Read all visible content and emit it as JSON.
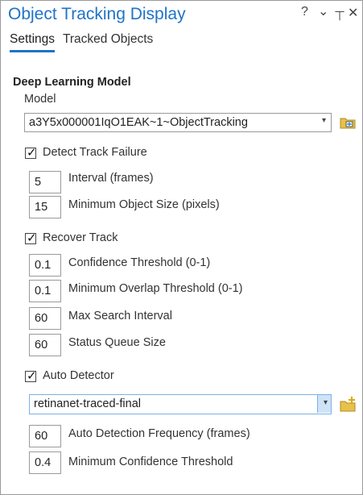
{
  "window": {
    "title": "Object Tracking Display",
    "help": "?",
    "menu": "⌄",
    "pin": "⊥",
    "close": "✕"
  },
  "tabs": [
    {
      "label": "Settings",
      "active": true
    },
    {
      "label": "Tracked Objects",
      "active": false
    }
  ],
  "section": {
    "title": "Deep Learning Model"
  },
  "model": {
    "label": "Model",
    "value": "a3Y5x000001IqO1EAK~1~ObjectTracking"
  },
  "detect_track_failure": {
    "label": "Detect Track Failure",
    "checked": true,
    "interval": {
      "label": "Interval (frames)",
      "value": "5"
    },
    "min_object_size": {
      "label": "Minimum Object Size (pixels)",
      "value": "15"
    }
  },
  "recover_track": {
    "label": "Recover Track",
    "checked": true,
    "confidence_threshold": {
      "label": "Confidence Threshold (0-1)",
      "value": "0.1"
    },
    "min_overlap_threshold": {
      "label": "Minimum Overlap Threshold (0-1)",
      "value": "0.1"
    },
    "max_search_interval": {
      "label": "Max Search Interval",
      "value": "60"
    },
    "status_queue_size": {
      "label": "Status Queue Size",
      "value": "60"
    }
  },
  "auto_detector": {
    "label": "Auto Detector",
    "checked": true,
    "value": "retinanet-traced-final",
    "detection_frequency": {
      "label": "Auto Detection Frequency (frames)",
      "value": "60"
    },
    "min_confidence": {
      "label": "Minimum Confidence Threshold",
      "value": "0.4"
    }
  },
  "icons": {
    "browse": "folder-browse-icon",
    "add": "folder-add-icon"
  },
  "colors": {
    "accent": "#1f73c8",
    "folder": "#e7c24a"
  }
}
